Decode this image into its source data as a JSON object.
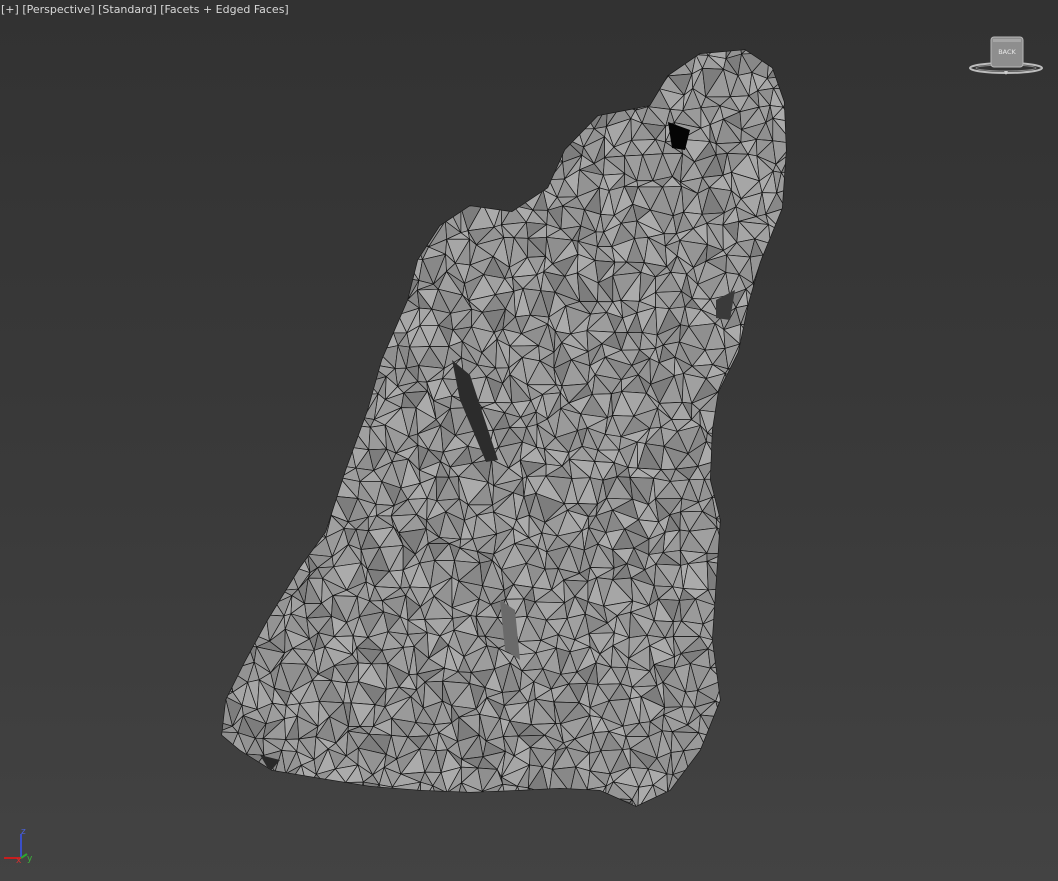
{
  "viewport": {
    "menu_plus": "[+]",
    "view_name": "[Perspective]",
    "shading_preset": "[Standard]",
    "display_mode": "[Facets + Edged Faces]"
  },
  "viewcube": {
    "face_label": "BACK"
  },
  "axis_tripod": {
    "z": "z",
    "x": "x",
    "y": "y"
  },
  "colors": {
    "mesh_fill": "#9b9b9b",
    "mesh_edge": "#141414",
    "axis_x": "#c81e1e",
    "axis_y": "#2ea52e",
    "axis_z": "#3a4fc8"
  }
}
